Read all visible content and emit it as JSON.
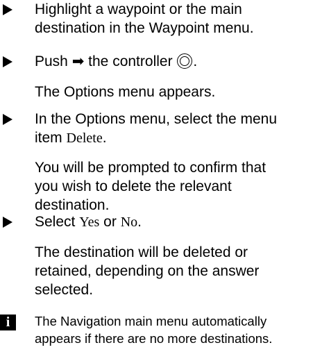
{
  "steps": [
    {
      "line1": "Highlight a waypoint or the main",
      "line2": "destination in the Waypoint menu."
    },
    {
      "push": "Push",
      "arrow": "➡",
      "after": "the controller",
      "end": ".",
      "result": "The Options menu appears."
    },
    {
      "line1": "In the Options menu, select the menu",
      "line2_pre": "item",
      "line2_item": "Delete",
      "line2_end": ".",
      "result_lines": [
        "You will be prompted to confirm that",
        "you wish to delete the relevant",
        "destination."
      ]
    },
    {
      "pre": "Select",
      "yes": "Yes",
      "mid": "or",
      "no": "No",
      "end": ".",
      "result_lines": [
        "The destination will be deleted or",
        "retained, depending on the answer",
        "selected."
      ]
    }
  ],
  "note": {
    "icon": "i",
    "lines": [
      "The Navigation main menu automatically",
      "appears if there are no more destinations."
    ]
  }
}
